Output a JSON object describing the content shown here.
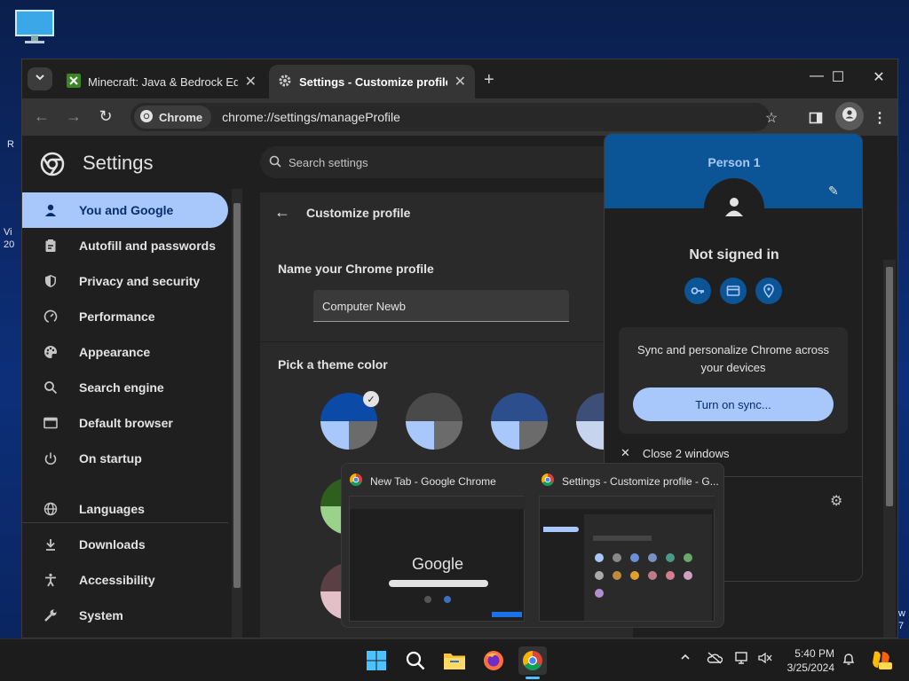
{
  "desktop": {
    "left_fragment_1": "R",
    "left_fragment_2": "Vi",
    "left_fragment_3": "20",
    "right_fragment_1": "w",
    "right_fragment_2": "7"
  },
  "browser": {
    "tabs": [
      {
        "label": "Minecraft: Java & Bedrock Edit",
        "icon": "minecraft-icon"
      },
      {
        "label": "Settings - Customize profile",
        "icon": "gear-icon",
        "active": true
      }
    ],
    "omnibox": {
      "chip_label": "Chrome",
      "url": "chrome://settings/manageProfile"
    }
  },
  "settings": {
    "title": "Settings",
    "search_placeholder": "Search settings",
    "nav": [
      {
        "label": "You and Google",
        "icon": "person-icon",
        "active": true
      },
      {
        "label": "Autofill and passwords",
        "icon": "clipboard-icon"
      },
      {
        "label": "Privacy and security",
        "icon": "shield-icon"
      },
      {
        "label": "Performance",
        "icon": "gauge-icon"
      },
      {
        "label": "Appearance",
        "icon": "palette-icon"
      },
      {
        "label": "Search engine",
        "icon": "search-icon"
      },
      {
        "label": "Default browser",
        "icon": "browser-icon"
      },
      {
        "label": "On startup",
        "icon": "power-icon"
      },
      {
        "label": "Languages",
        "icon": "globe-icon"
      },
      {
        "label": "Downloads",
        "icon": "download-icon"
      },
      {
        "label": "Accessibility",
        "icon": "accessibility-icon"
      },
      {
        "label": "System",
        "icon": "wrench-icon"
      }
    ],
    "customize": {
      "header": "Customize profile",
      "name_label": "Name your Chrome profile",
      "name_value": "Computer Newb",
      "theme_label": "Pick a theme color",
      "swatches": [
        {
          "top": "#0b4aa6",
          "bl": "#a8c7fa",
          "br": "#6b6b6b",
          "selected": true
        },
        {
          "top": "#4a4a4a",
          "bl": "#a8c7fa",
          "br": "#6b6b6b"
        },
        {
          "top": "#2d4e8c",
          "bl": "#a8c7fa",
          "br": "#6b6b6b"
        },
        {
          "top": "#3d4e78",
          "bl": "#c7d4ee",
          "br": "#6b6b6b"
        },
        {
          "top": "#2f5f1f",
          "bl": "#9ad18b",
          "br": "#6b6b6b"
        },
        {
          "top": "#5a3f45",
          "bl": "#e3c0c8",
          "br": "#6b6b6b"
        }
      ]
    }
  },
  "profile_popup": {
    "person": "Person 1",
    "status": "Not signed in",
    "sync_text": "Sync and personalize Chrome across your devices",
    "sync_button": "Turn on sync...",
    "close_windows": "Close 2 windows"
  },
  "thumbnails": [
    {
      "title": "New Tab - Google Chrome",
      "preview_text": "Google"
    },
    {
      "title": "Settings - Customize profile - G..."
    }
  ],
  "taskbar": {
    "time": "5:40 PM",
    "date": "3/25/2024"
  }
}
